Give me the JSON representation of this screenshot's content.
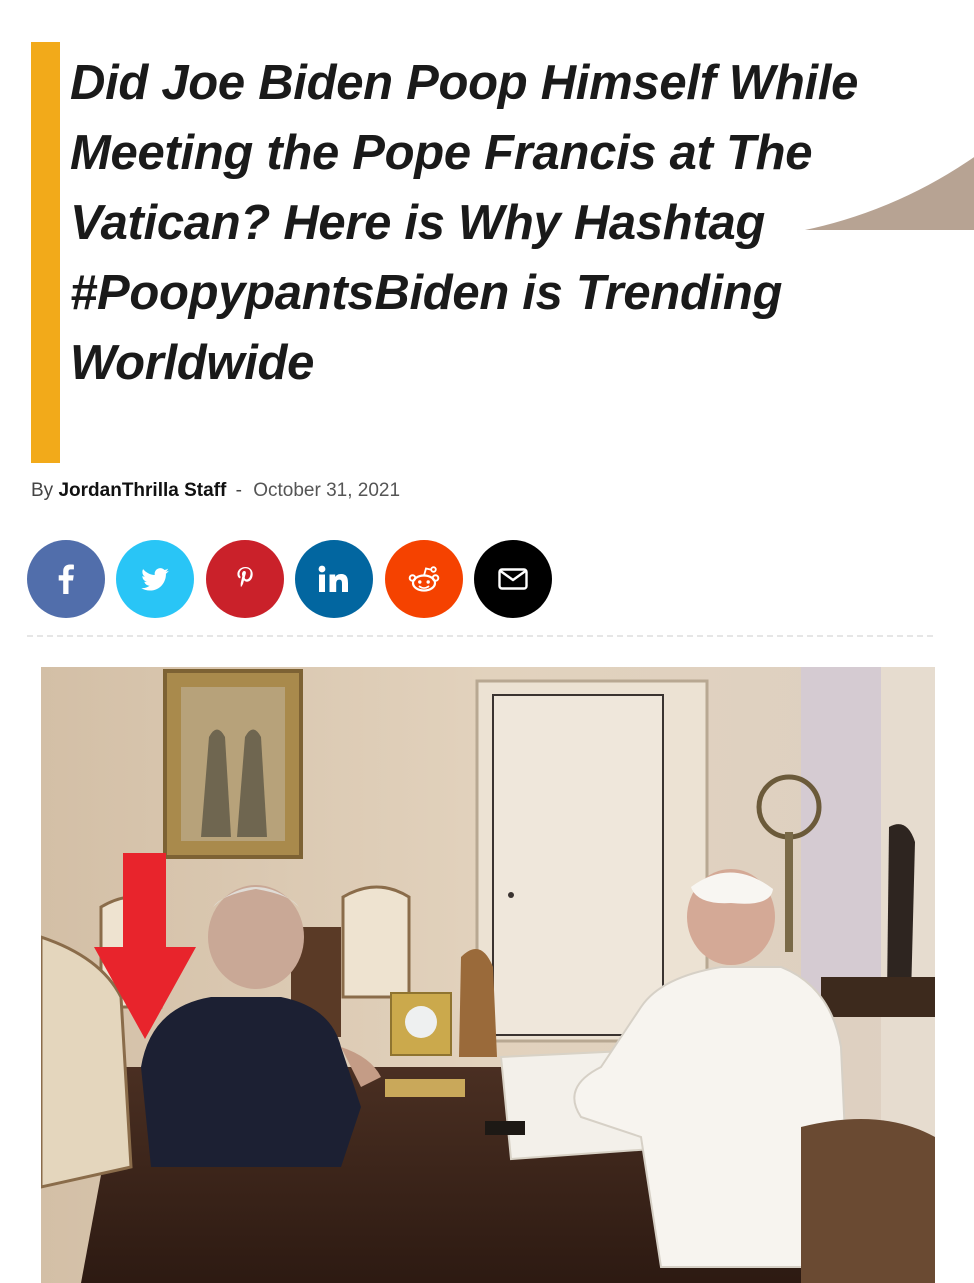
{
  "article": {
    "title": "Did Joe Biden Poop Himself While Meeting the Pope Francis at The Vatican? Here is Why Hashtag #PoopypantsBiden is Trending Worldwide",
    "byline_prefix": "By",
    "author": "JordanThrilla Staff",
    "separator": "-",
    "date": "October 31, 2021"
  },
  "share": {
    "buttons": [
      {
        "network": "facebook",
        "icon": "facebook-icon",
        "color": "#516eab"
      },
      {
        "network": "twitter",
        "icon": "twitter-icon",
        "color": "#29c5f6"
      },
      {
        "network": "pinterest",
        "icon": "pinterest-icon",
        "color": "#ca212a"
      },
      {
        "network": "linkedin",
        "icon": "linkedin-icon",
        "color": "#0266a0"
      },
      {
        "network": "reddit",
        "icon": "reddit-icon",
        "color": "#f54200"
      },
      {
        "network": "email",
        "icon": "envelope-icon",
        "color": "#000000"
      }
    ]
  },
  "colors": {
    "title_accent_bar": "#f2aa1a",
    "annotation_arrow": "#e8242c"
  }
}
